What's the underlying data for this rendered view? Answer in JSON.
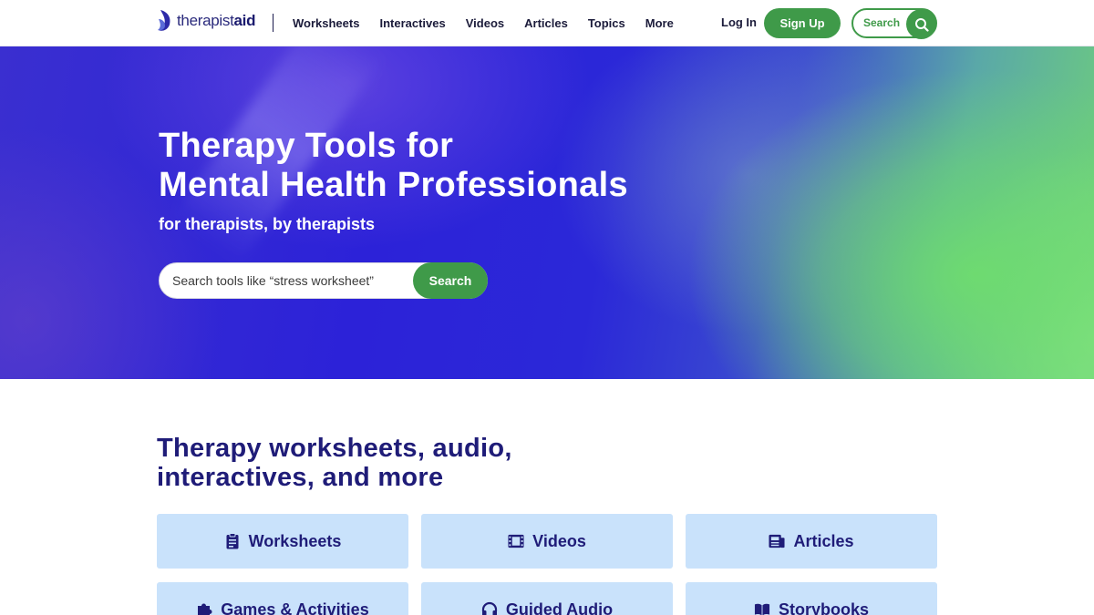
{
  "header": {
    "logo_light": "therapist",
    "logo_bold": "aid",
    "nav": [
      "Worksheets",
      "Interactives",
      "Videos",
      "Articles",
      "Topics",
      "More"
    ],
    "login_label": "Log In",
    "signup_label": "Sign Up",
    "search_label": "Search"
  },
  "hero": {
    "title_line1": "Therapy Tools for",
    "title_line2": "Mental Health Professionals",
    "subtitle": "for therapists, by therapists",
    "search_placeholder": "Search tools like “stress worksheet”",
    "search_button": "Search"
  },
  "section": {
    "title_line1": "Therapy worksheets, audio,",
    "title_line2": "interactives, and more",
    "cards": [
      {
        "label": "Worksheets",
        "icon": "clipboard-icon"
      },
      {
        "label": "Videos",
        "icon": "film-icon"
      },
      {
        "label": "Articles",
        "icon": "newspaper-icon"
      },
      {
        "label": "Games & Activities",
        "icon": "puzzle-icon"
      },
      {
        "label": "Guided Audio",
        "icon": "headphones-icon"
      },
      {
        "label": "Storybooks",
        "icon": "book-icon"
      }
    ]
  },
  "colors": {
    "brand_navy": "#1f1c78",
    "accent_green": "#3f9a49",
    "card_bg": "#c9e2fb"
  }
}
